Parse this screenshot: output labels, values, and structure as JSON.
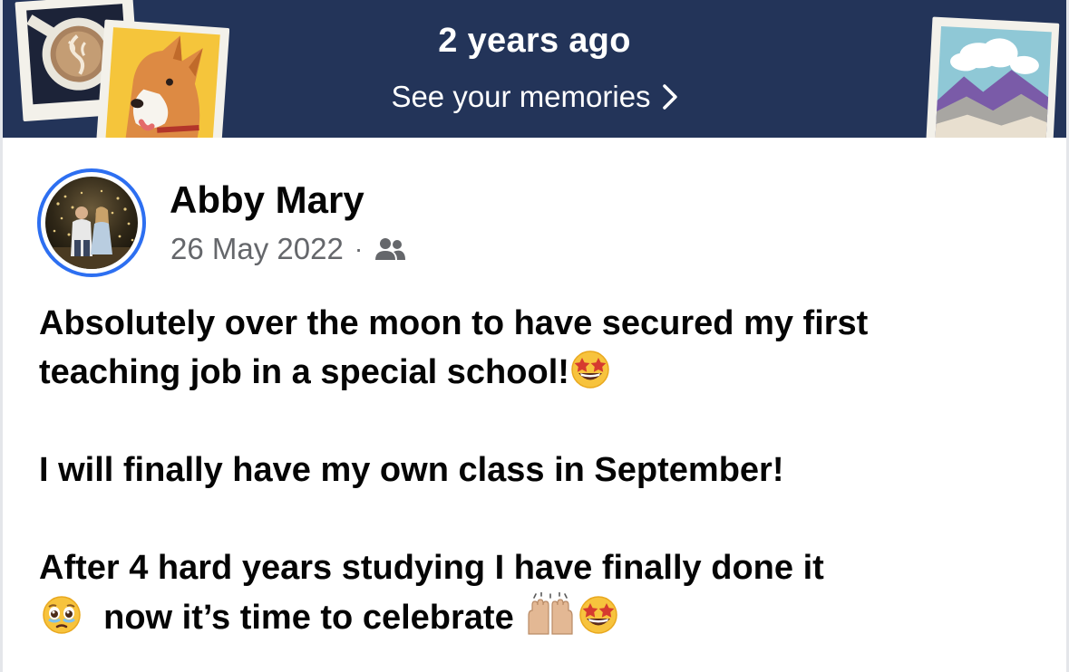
{
  "banner": {
    "title": "2 years ago",
    "link_label": "See your memories",
    "background": "#233459"
  },
  "post": {
    "author": "Abby Mary",
    "date": "26 May 2022",
    "separator": "·",
    "audience_icon": "friends-icon",
    "paragraphs": [
      {
        "line1": "Absolutely over the moon to have secured my first",
        "line2": "teaching job in a special school!",
        "line2_emoji": "star-struck-emoji"
      },
      {
        "line1": "I will finally have my own class in September!"
      },
      {
        "line1": "After 4 hard years studying I have finally done it",
        "line2_emoji_before": "holding-back-tears-emoji",
        "line2": "now it’s time to celebrate",
        "line2_emojis_after": [
          "raising-hands-emoji",
          "star-struck-emoji"
        ]
      }
    ]
  },
  "colors": {
    "avatar_ring": "#2d6ff1",
    "text_primary": "#050505",
    "text_secondary": "#65676b"
  }
}
